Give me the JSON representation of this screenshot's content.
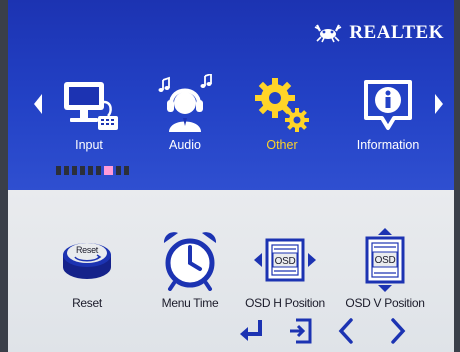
{
  "brand": {
    "name": "REALTEK"
  },
  "main_menu": {
    "items": [
      {
        "label": "Input",
        "icon": "computer-icon"
      },
      {
        "label": "Audio",
        "icon": "headset-person-icon"
      },
      {
        "label": "Other",
        "icon": "gear-icon"
      },
      {
        "label": "Information",
        "icon": "info-speech-icon"
      }
    ],
    "selected": "Other",
    "page_indicator": {
      "total": 9,
      "active_index": 6
    }
  },
  "sub_menu": {
    "items": [
      {
        "label": "Reset",
        "icon": "reset-button-icon"
      },
      {
        "label": "Menu Time",
        "icon": "alarm-clock-icon"
      },
      {
        "label": "OSD H Position",
        "icon": "osd-horizontal-icon"
      },
      {
        "label": "OSD V Position",
        "icon": "osd-vertical-icon"
      }
    ]
  },
  "nav_buttons": [
    "enter-icon",
    "exit-icon",
    "left-icon",
    "right-icon"
  ],
  "colors": {
    "top_panel": "#2342c6",
    "bottom_panel": "#e6e9ec",
    "selected_label": "#ffd428",
    "indicator_active": "#ff9bd9",
    "icon_blue": "#1c33b2"
  }
}
